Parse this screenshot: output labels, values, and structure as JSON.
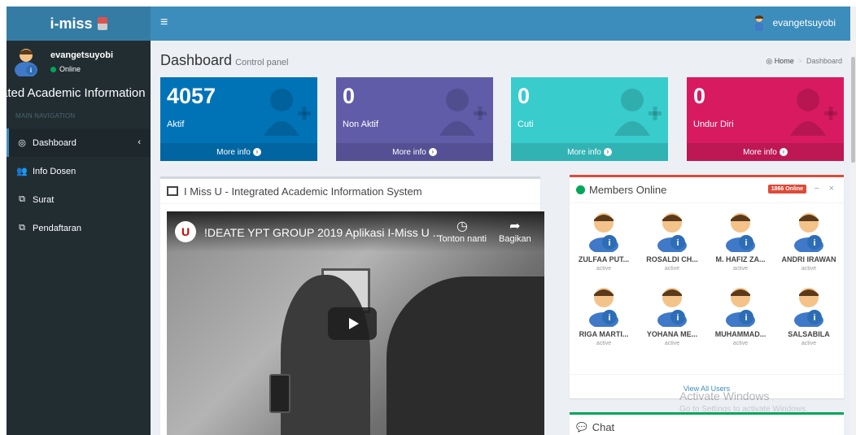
{
  "brand": {
    "name": "i-miss"
  },
  "navbar": {
    "toggle": "≡",
    "username": "evangetsuyobi"
  },
  "sidebar": {
    "user": {
      "name": "evangetsuyobi",
      "status": "Online"
    },
    "system_title": "rated Academic Information",
    "header": "MAIN NAVIGATION",
    "items": [
      {
        "label": "Dashboard",
        "icon": "dashboard-icon",
        "glyph": "◎",
        "caret": "‹"
      },
      {
        "label": "Info Dosen",
        "icon": "users-icon",
        "glyph": "👥"
      },
      {
        "label": "Surat",
        "icon": "copy-icon",
        "glyph": "⧉"
      },
      {
        "label": "Pendaftaran",
        "icon": "copy-icon",
        "glyph": "⧉"
      }
    ]
  },
  "content_header": {
    "title": "Dashboard",
    "subtitle": "Control panel"
  },
  "breadcrumb": {
    "home": "Home",
    "current": "Dashboard",
    "home_glyph": "◎"
  },
  "stat_boxes": [
    {
      "value": "4057",
      "label": "Aktif",
      "color": "#0073b7",
      "more": "More info"
    },
    {
      "value": "0",
      "label": "Non Aktif",
      "color": "#605ca8",
      "more": "More info"
    },
    {
      "value": "0",
      "label": "Cuti",
      "color": "#39cccc",
      "more": "More info"
    },
    {
      "value": "0",
      "label": "Undur Diri",
      "color": "#d81b60",
      "more": "More info"
    }
  ],
  "video_box": {
    "title": "I Miss U - Integrated Academic Information System",
    "video_title": "!DEATE YPT GROUP 2019 Aplikasi I-Miss U ...",
    "channel_glyph": "U",
    "watch_later": "Tonton nanti",
    "share": "Bagikan"
  },
  "members_box": {
    "title": "Members Online",
    "badge": "1866 Online",
    "minimize": "−",
    "close": "×",
    "members": [
      {
        "name": "ZULFAA PUT...",
        "status": "active"
      },
      {
        "name": "ROSALDI CH...",
        "status": "active"
      },
      {
        "name": "M. HAFIZ ZA...",
        "status": "active"
      },
      {
        "name": "ANDRI IRAWAN",
        "status": "active"
      },
      {
        "name": "RIGA MARTI...",
        "status": "active"
      },
      {
        "name": "YOHANA ME...",
        "status": "active"
      },
      {
        "name": "MUHAMMAD...",
        "status": "active"
      },
      {
        "name": "SALSABILA",
        "status": "active"
      }
    ],
    "view_all": "View All Users"
  },
  "watermark": {
    "line1": "Activate Windows",
    "line2": "Go to Settings to activate Windows."
  },
  "chat_box": {
    "title": "Chat",
    "glyph": "💬"
  }
}
